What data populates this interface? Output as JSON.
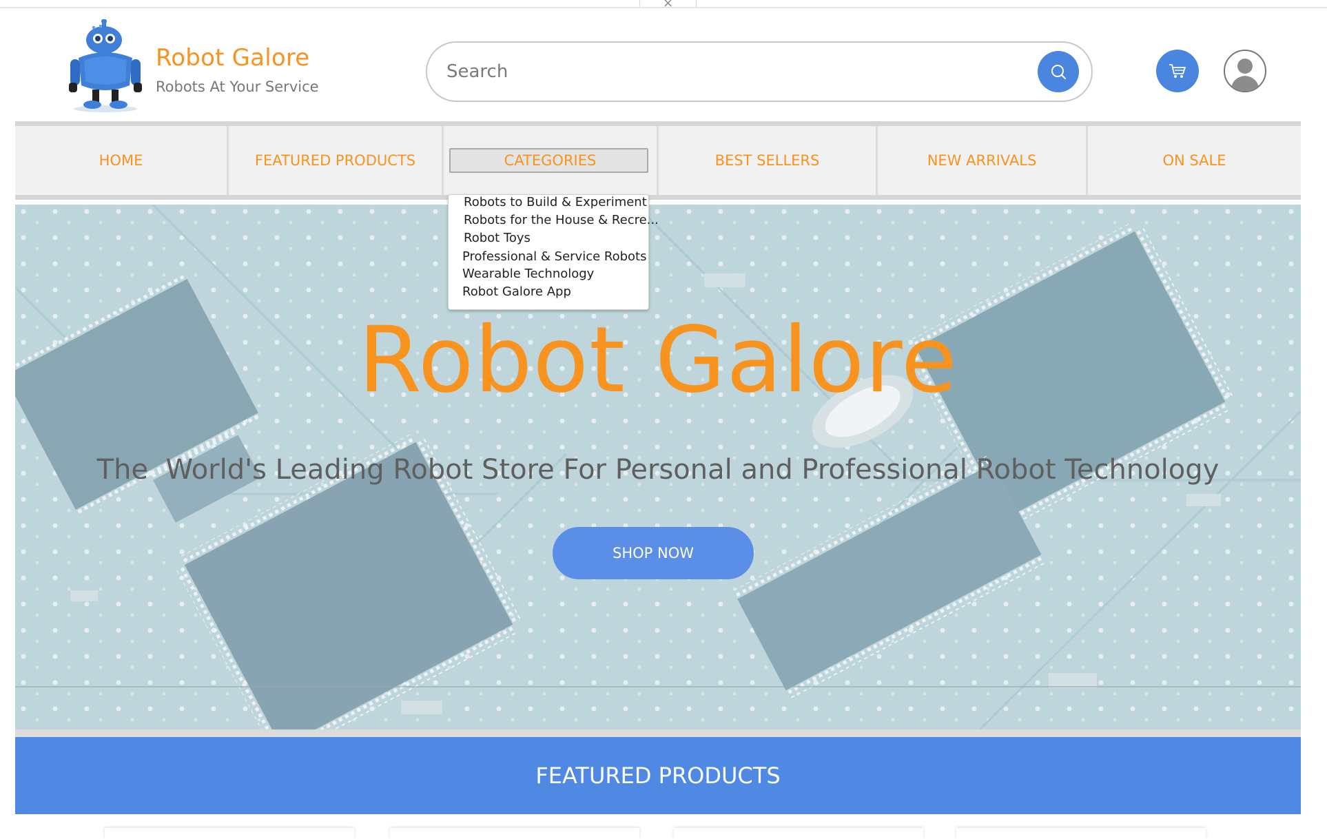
{
  "brand": {
    "name": "Robot Galore",
    "tagline": "Robots At Your Service"
  },
  "search": {
    "placeholder": "Search"
  },
  "nav": {
    "items": [
      {
        "label": "HOME"
      },
      {
        "label": "FEATURED PRODUCTS"
      },
      {
        "label": "CATEGORIES",
        "active": true
      },
      {
        "label": "BEST SELLERS"
      },
      {
        "label": "NEW ARRIVALS"
      },
      {
        "label": "ON SALE"
      }
    ]
  },
  "categories_dropdown": {
    "items": [
      "Robots to Build & Experiment",
      "Robots for the House & Recre...",
      "Robot Toys",
      "Professional & Service Robots",
      "Wearable Technology",
      "Robot Galore App"
    ]
  },
  "hero": {
    "title": "Robot Galore",
    "subtitle": "The  World's Leading Robot Store For Personal and Professional Robot Technology",
    "cta_label": "SHOP NOW"
  },
  "featured": {
    "heading": "FEATURED PRODUCTS"
  },
  "colors": {
    "accent_orange": "#f7931e",
    "accent_blue": "#4f89e4",
    "nav_bg": "#f1f1f1"
  },
  "icons": {
    "search": "search-icon",
    "cart": "cart-icon",
    "user": "user-avatar-icon",
    "logo": "robot-mascot-logo"
  }
}
